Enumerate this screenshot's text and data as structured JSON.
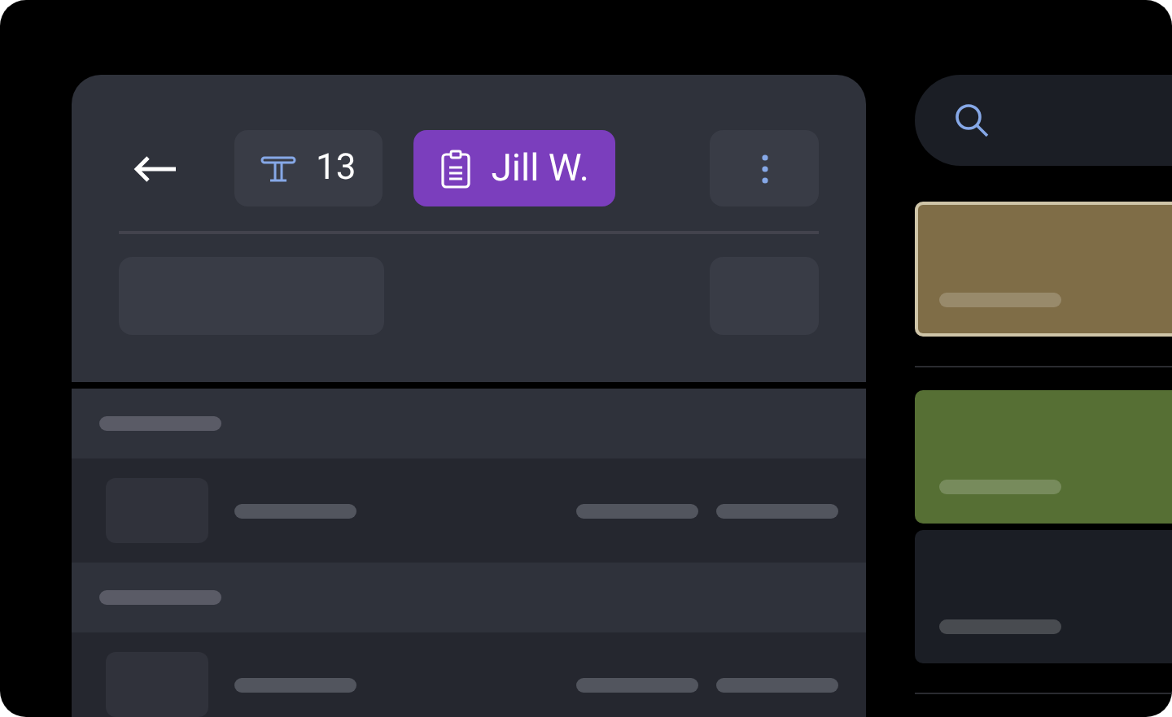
{
  "order_header": {
    "table_number": "13",
    "server_name": "Jill W."
  },
  "menu_tiles": [
    {
      "color": "#7f6d47",
      "selected": true
    },
    {
      "color": "#566f34",
      "selected": false
    },
    {
      "color": "#1b1e25",
      "selected": false
    }
  ]
}
